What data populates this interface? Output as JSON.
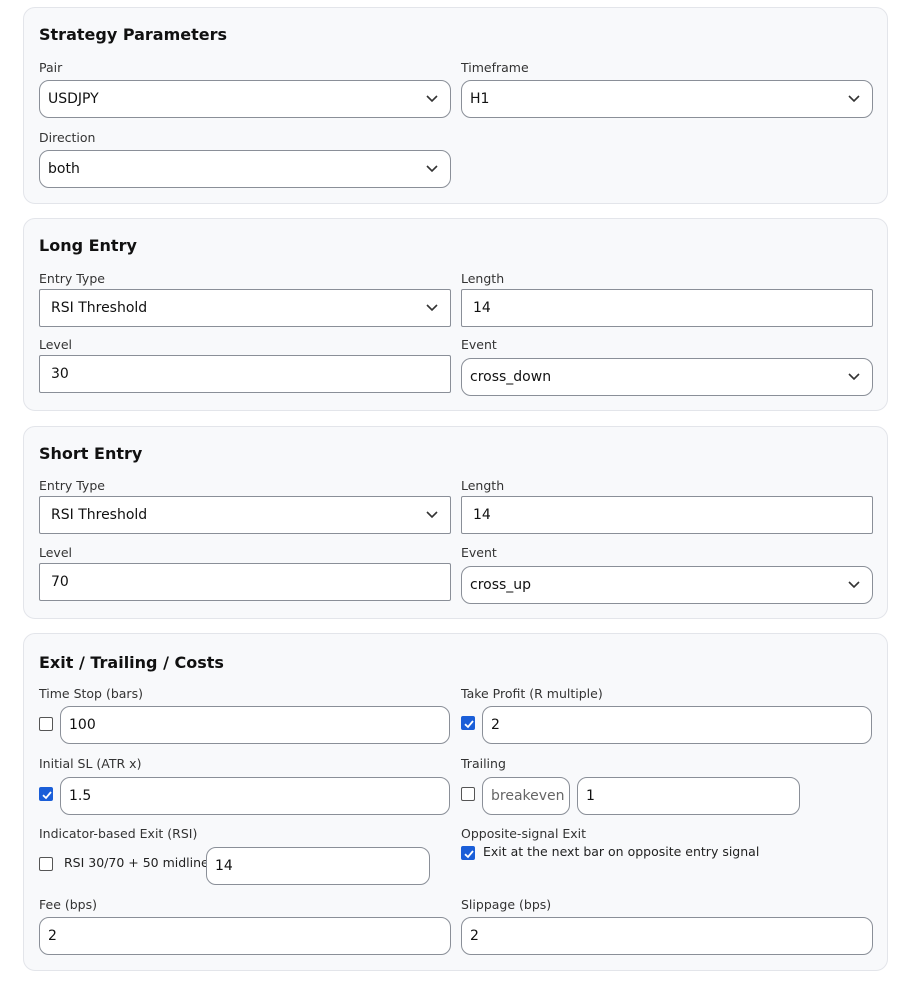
{
  "strategy": {
    "title": "Strategy Parameters",
    "pair_label": "Pair",
    "pair_value": "USDJPY",
    "timeframe_label": "Timeframe",
    "timeframe_value": "H1",
    "direction_label": "Direction",
    "direction_value": "both"
  },
  "long_entry": {
    "title": "Long Entry",
    "entry_type_label": "Entry Type",
    "entry_type_value": "RSI Threshold",
    "length_label": "Length",
    "length_value": "14",
    "level_label": "Level",
    "level_value": "30",
    "event_label": "Event",
    "event_value": "cross_down"
  },
  "short_entry": {
    "title": "Short Entry",
    "entry_type_label": "Entry Type",
    "entry_type_value": "RSI Threshold",
    "length_label": "Length",
    "length_value": "14",
    "level_label": "Level",
    "level_value": "70",
    "event_label": "Event",
    "event_value": "cross_up"
  },
  "exit": {
    "title": "Exit / Trailing / Costs",
    "time_stop_label": "Time Stop (bars)",
    "time_stop_checked": false,
    "time_stop_value": "100",
    "take_profit_label": "Take Profit (R multiple)",
    "take_profit_checked": true,
    "take_profit_value": "2",
    "initial_sl_label": "Initial SL (ATR x)",
    "initial_sl_checked": true,
    "initial_sl_value": "1.5",
    "trailing_label": "Trailing",
    "trailing_checked": false,
    "trailing_mode": "breakeven",
    "trailing_value": "1",
    "indicator_exit_label": "Indicator-based Exit (RSI)",
    "indicator_exit_checked": false,
    "indicator_exit_text": "RSI 30/70 + 50 midline",
    "indicator_exit_value": "14",
    "opposite_exit_label": "Opposite-signal Exit",
    "opposite_exit_checked": true,
    "opposite_exit_text": "Exit at the next bar on opposite entry signal",
    "fee_label": "Fee (bps)",
    "fee_value": "2",
    "slippage_label": "Slippage (bps)",
    "slippage_value": "2"
  },
  "colors": {
    "accent": "#1a5ed8",
    "card_bg": "#f8f9fb",
    "border": "#8a8f98"
  }
}
